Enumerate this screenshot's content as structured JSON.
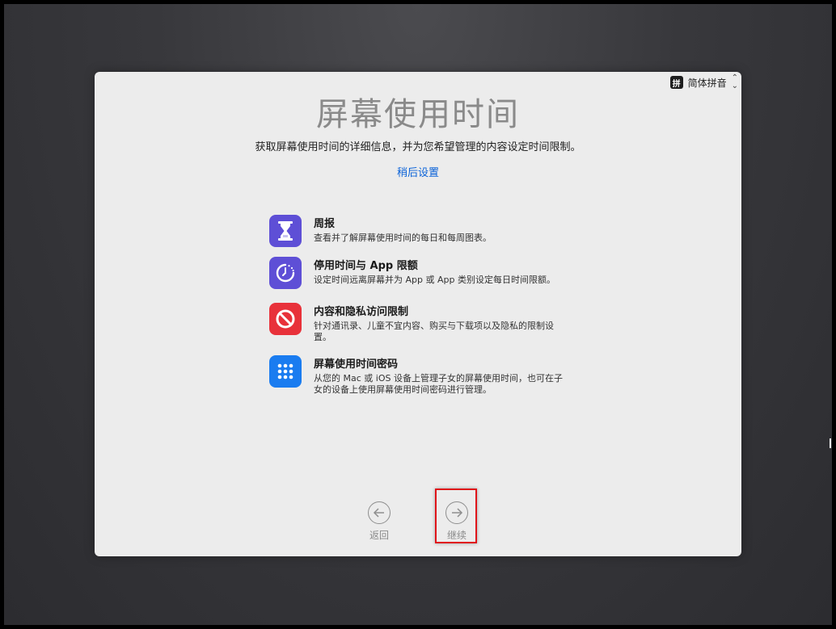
{
  "input_method": {
    "badge": "拼",
    "label": "简体拼音",
    "icon": "updown-chevron-icon"
  },
  "title": "屏幕使用时间",
  "subtitle": "获取屏幕使用时间的详细信息，并为您希望管理的内容设定时间限制。",
  "later_link": "稍后设置",
  "features": [
    {
      "title": "周报",
      "desc": "查看并了解屏幕使用时间的每日和每周图表。",
      "icon": "hourglass-icon",
      "color": "#5e4fd6"
    },
    {
      "title": "停用时间与 App 限额",
      "desc": "设定时间远离屏幕并为 App 或 App 类别设定每日时间限额。",
      "icon": "downtime-icon",
      "color": "#5e4fd6"
    },
    {
      "title": "内容和隐私访问限制",
      "desc": "针对通讯录、儿童不宜内容、购买与下载项以及隐私的限制设置。",
      "icon": "no-entry-icon",
      "color": "#e8313a"
    },
    {
      "title": "屏幕使用时间密码",
      "desc": "从您的 Mac 或 iOS 设备上管理子女的屏幕使用时间，也可在子女的设备上使用屏幕使用时间密码进行管理。",
      "icon": "passcode-grid-icon",
      "color": "#1a7cf0"
    }
  ],
  "nav": {
    "back_label": "返回",
    "continue_label": "继续"
  },
  "colors": {
    "accent_link": "#0a62d8",
    "highlight": "#e0141a"
  }
}
